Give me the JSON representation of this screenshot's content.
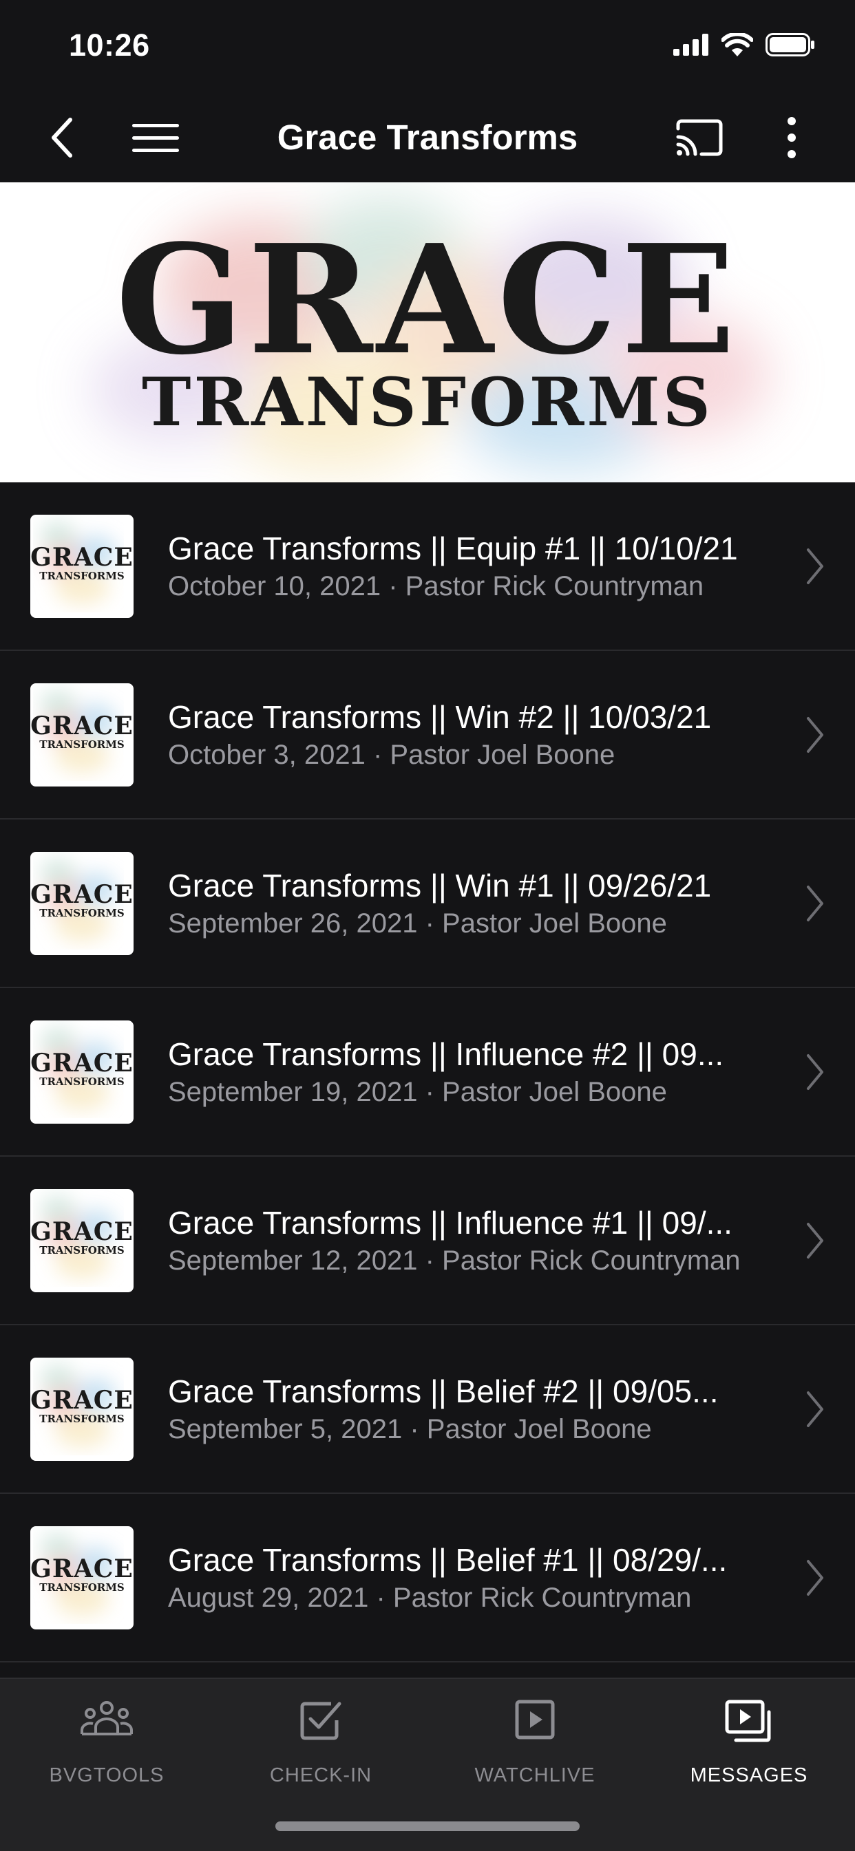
{
  "status": {
    "time": "10:26"
  },
  "nav": {
    "title": "Grace Transforms"
  },
  "hero": {
    "line1": "GRACE",
    "line2": "TRANSFORMS"
  },
  "thumb": {
    "line1": "GRACE",
    "line2": "TRANSFORMS"
  },
  "messages": [
    {
      "title": "Grace Transforms || Equip #1 || 10/10/21",
      "subtitle": "October 10, 2021 · Pastor Rick Countryman"
    },
    {
      "title": "Grace Transforms || Win #2 || 10/03/21",
      "subtitle": "October 3, 2021 · Pastor Joel Boone"
    },
    {
      "title": "Grace Transforms || Win #1 || 09/26/21",
      "subtitle": "September 26, 2021 · Pastor Joel Boone"
    },
    {
      "title": "Grace Transforms || Influence #2 || 09...",
      "subtitle": "September 19, 2021 · Pastor Joel Boone"
    },
    {
      "title": "Grace Transforms || Influence #1 || 09/...",
      "subtitle": "September 12, 2021 · Pastor Rick Countryman"
    },
    {
      "title": "Grace Transforms || Belief #2 || 09/05...",
      "subtitle": "September 5, 2021 · Pastor Joel Boone"
    },
    {
      "title": "Grace Transforms || Belief #1 || 08/29/...",
      "subtitle": "August 29, 2021 · Pastor Rick Countryman"
    }
  ],
  "tabs": [
    {
      "label": "BVGTOOLS",
      "icon": "people-icon",
      "active": false
    },
    {
      "label": "CHECK-IN",
      "icon": "checkbox-icon",
      "active": false
    },
    {
      "label": "WATCHLIVE",
      "icon": "play-icon",
      "active": false
    },
    {
      "label": "MESSAGES",
      "icon": "messages-icon",
      "active": true
    }
  ],
  "colors": {
    "background": "#141416",
    "tabbar": "#232325",
    "subtext": "#9a9aa0",
    "inactive": "#8d8d92"
  }
}
